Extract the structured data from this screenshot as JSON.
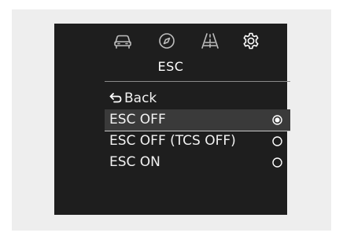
{
  "screen": {
    "title": "ESC",
    "tabs": [
      {
        "icon": "car-icon",
        "active": false
      },
      {
        "icon": "compass-icon",
        "active": false
      },
      {
        "icon": "road-icon",
        "active": false
      },
      {
        "icon": "gear-icon",
        "active": true
      }
    ],
    "menu": {
      "back_label": "Back",
      "options": [
        {
          "label": "ESC OFF",
          "selected": true
        },
        {
          "label": "ESC OFF (TCS OFF)",
          "selected": false
        },
        {
          "label": "ESC ON",
          "selected": false
        }
      ]
    }
  },
  "colors": {
    "screen_background": "#1e1e1e",
    "highlight": "#3a3a3a",
    "text": "#ffffff"
  }
}
